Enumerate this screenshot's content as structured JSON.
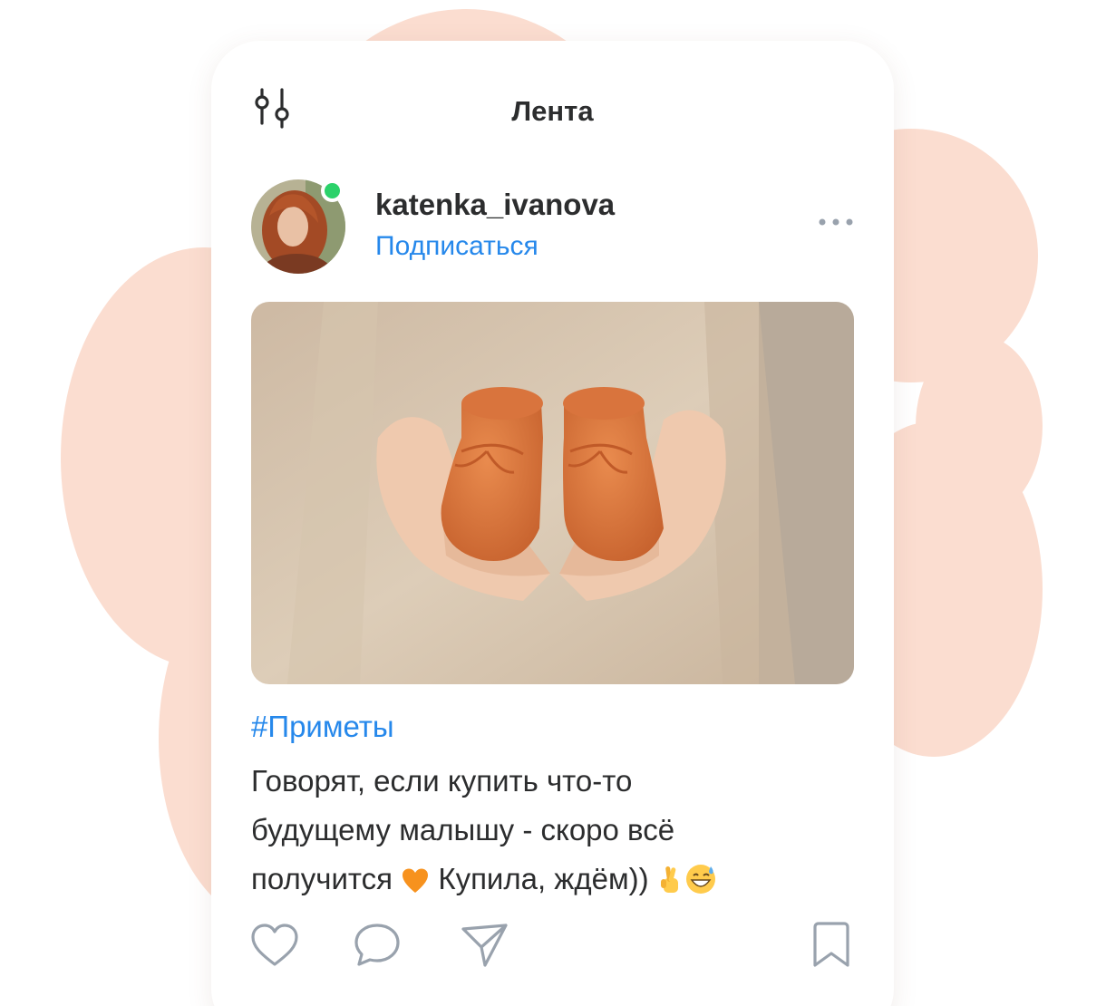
{
  "screen": {
    "title": "Лента"
  },
  "post": {
    "author": {
      "username": "katenka_ivanova",
      "subscribe_label": "Подписаться",
      "online": true
    },
    "hashtag": "#Приметы",
    "text": {
      "line1": "Говорят, если купить что-то",
      "line2": "будущему малышу - скоро всё",
      "line3_start": "получится ",
      "line3_middle": " Купила, ждём)) "
    },
    "emojis": [
      "orange-heart-icon",
      "crossed-fingers-icon",
      "grinning-sweat-icon"
    ],
    "image_subject": "hands holding knitted orange baby booties"
  },
  "icons": {
    "filter": "filter-sliders-icon",
    "more": "more-dots-icon",
    "like": "heart-icon",
    "comment": "comment-icon",
    "share": "share-icon",
    "save": "bookmark-icon"
  },
  "colors": {
    "accent": "#2688eb",
    "text": "#2c2d2e",
    "online": "#2bd26a",
    "background_blob": "#fbddd0",
    "icon_gray": "#99a2ad"
  }
}
